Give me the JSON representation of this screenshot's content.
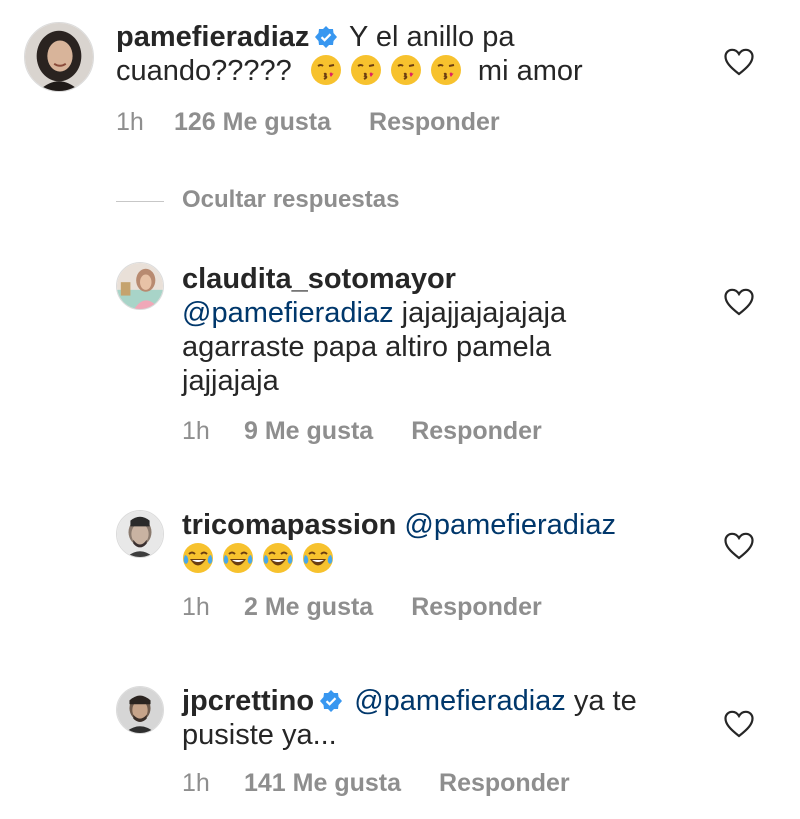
{
  "comments": [
    {
      "username": "pamefieradiaz",
      "verified": true,
      "text_a": "Y el anillo pa",
      "text_b": "cuando?????",
      "text_c": "mi amor",
      "emoji": "face-blowing-a-kiss",
      "emoji_count": 4,
      "time": "1h",
      "likes": "126 Me gusta",
      "reply": "Responder"
    },
    {
      "username": "claudita_sotomayor",
      "mention": "@pamefieradiaz",
      "text_a": "jajajjajajajaja",
      "text_b": "agarraste papa altiro pamela",
      "text_c": "jajjajaja",
      "time": "1h",
      "likes": "9 Me gusta",
      "reply": "Responder"
    },
    {
      "username": "tricomapassion",
      "mention": "@pamefieradiaz",
      "emoji": "face-with-tears-of-joy",
      "emoji_count": 4,
      "time": "1h",
      "likes": "2 Me gusta",
      "reply": "Responder"
    },
    {
      "username": "jpcrettino",
      "verified": true,
      "mention": "@pamefieradiaz",
      "text_a": "ya te",
      "text_b": "pusiste ya...",
      "time": "1h",
      "likes": "141 Me gusta",
      "reply": "Responder"
    }
  ],
  "hide_replies_label": "Ocultar respuestas",
  "colors": {
    "text": "#262626",
    "meta": "#8e8e8e",
    "mention": "#00376b",
    "verified": "#3897f0"
  }
}
